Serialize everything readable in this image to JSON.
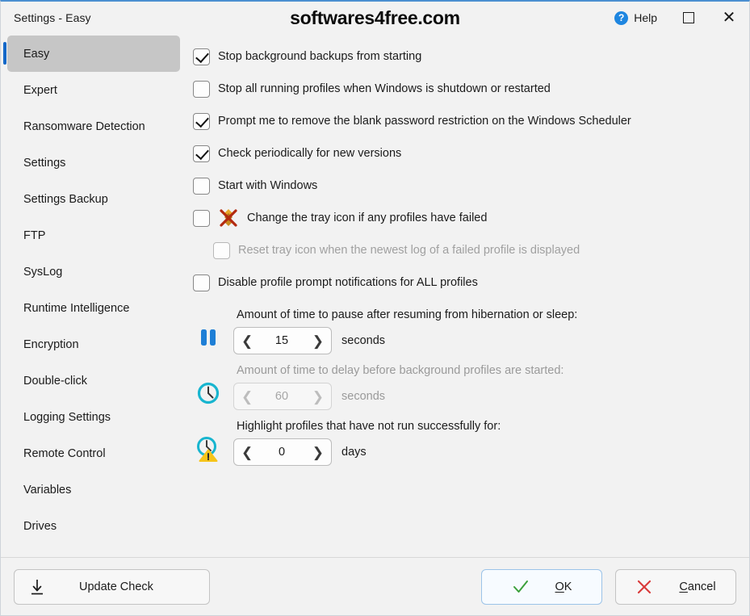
{
  "titlebar": {
    "title": "Settings - Easy",
    "watermark": "softwares4free.com",
    "help_label": "Help",
    "help_icon": "question-circle-icon",
    "maximize_icon": "maximize-icon",
    "close_icon": "close-icon"
  },
  "sidebar": {
    "items": [
      {
        "label": "Easy",
        "selected": true
      },
      {
        "label": "Expert",
        "selected": false
      },
      {
        "label": "Ransomware Detection",
        "selected": false
      },
      {
        "label": "Settings",
        "selected": false
      },
      {
        "label": "Settings Backup",
        "selected": false
      },
      {
        "label": "FTP",
        "selected": false
      },
      {
        "label": "SysLog",
        "selected": false
      },
      {
        "label": "Runtime Intelligence",
        "selected": false
      },
      {
        "label": "Encryption",
        "selected": false
      },
      {
        "label": "Double-click",
        "selected": false
      },
      {
        "label": "Logging Settings",
        "selected": false
      },
      {
        "label": "Remote Control",
        "selected": false
      },
      {
        "label": "Variables",
        "selected": false
      },
      {
        "label": "Drives",
        "selected": false
      }
    ]
  },
  "main": {
    "checkboxes": [
      {
        "label": "Stop background backups from starting",
        "checked": true,
        "enabled": true,
        "indent": false,
        "icon": null
      },
      {
        "label": "Stop all running profiles when Windows is shutdown or restarted",
        "checked": false,
        "enabled": true,
        "indent": false,
        "icon": null
      },
      {
        "label": "Prompt me to remove the blank password restriction on the Windows Scheduler",
        "checked": true,
        "enabled": true,
        "indent": false,
        "icon": null
      },
      {
        "label": "Check periodically for new versions",
        "checked": true,
        "enabled": true,
        "indent": false,
        "icon": null
      },
      {
        "label": "Start with Windows",
        "checked": false,
        "enabled": true,
        "indent": false,
        "icon": null
      },
      {
        "label": "Change the tray icon if any profiles have failed",
        "checked": false,
        "enabled": true,
        "indent": false,
        "icon": "failed-tray-icon"
      },
      {
        "label": "Reset tray icon when the newest log of a failed profile is displayed",
        "checked": false,
        "enabled": false,
        "indent": true,
        "icon": null
      },
      {
        "label": "Disable profile prompt notifications for ALL profiles",
        "checked": false,
        "enabled": true,
        "indent": false,
        "icon": null
      }
    ],
    "spinners": [
      {
        "icon": "pause-icon",
        "caption": "Amount of time to pause after resuming from hibernation or sleep:",
        "value": "15",
        "unit": "seconds",
        "enabled": true,
        "dec_icon": "chevron-left-icon",
        "inc_icon": "chevron-right-icon"
      },
      {
        "icon": "clock-icon",
        "caption": "Amount of time to delay before background profiles are started:",
        "value": "60",
        "unit": "seconds",
        "enabled": false,
        "dec_icon": "chevron-left-icon",
        "inc_icon": "chevron-right-icon"
      },
      {
        "icon": "clock-warning-icon",
        "caption": "Highlight profiles that have not run successfully for:",
        "value": "0",
        "unit": "days",
        "enabled": true,
        "dec_icon": "chevron-left-icon",
        "inc_icon": "chevron-right-icon"
      }
    ]
  },
  "footer": {
    "update_check": {
      "label": "Update Check",
      "icon": "download-arrow-icon"
    },
    "ok": {
      "label_pre": "",
      "label_key": "O",
      "label_post": "K",
      "icon": "check-icon"
    },
    "cancel": {
      "label_key": "C",
      "label_post": "ancel",
      "icon": "cross-icon"
    }
  },
  "colors": {
    "accent": "#1468c8",
    "selected_nav_bg": "#c6c6c6",
    "window_bg": "#f2f2f2",
    "help_blue": "#1e86e0",
    "ok_green": "#3ba03b",
    "cancel_red": "#d93a3a",
    "clock_cyan": "#18b5cf",
    "warn_yellow": "#f6c41a",
    "pause_blue": "#1e7fd6",
    "tray_gold": "#e0a020",
    "tray_x_red": "#b03010"
  }
}
